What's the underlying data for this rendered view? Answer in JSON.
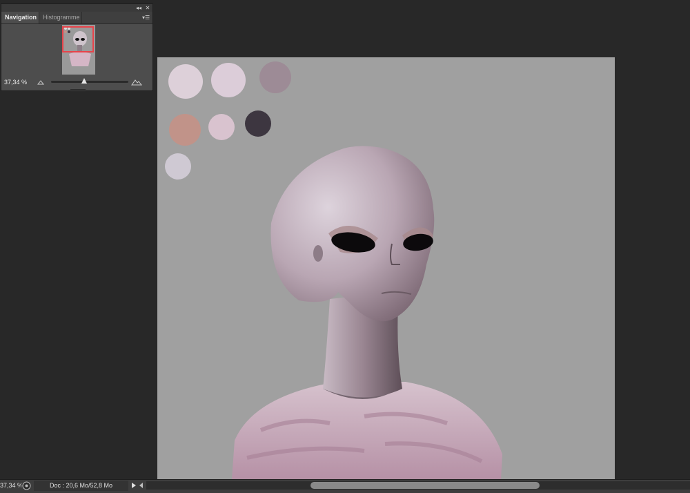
{
  "navigator": {
    "tabs": [
      {
        "label": "Navigation",
        "active": true
      },
      {
        "label": "Histogramme",
        "active": false
      }
    ],
    "zoom_value": "37,34 %",
    "zoom_slider_fraction": 0.42,
    "icons": {
      "collapse": "double-chevron-left-icon",
      "close": "close-icon",
      "menu": "panel-menu-icon",
      "zoom_out": "small-mountain-icon",
      "zoom_in": "large-mountain-icon"
    }
  },
  "canvas": {
    "background_color": "#a0a0a0",
    "swatches": [
      "#ddd0d9",
      "#dccdd9",
      "#9d8b96",
      "#c19389",
      "#d9c3cf",
      "#3d3640",
      "#cfc9d3"
    ],
    "subject": "alien portrait painting"
  },
  "status_bar": {
    "zoom_text": "37,34 %",
    "doc_info": "Doc : 20,6 Mo/52,8 Mo"
  },
  "colors": {
    "ui_dark": "#282828",
    "panel": "#4d4d4d",
    "highlight_red": "#e8434a"
  }
}
